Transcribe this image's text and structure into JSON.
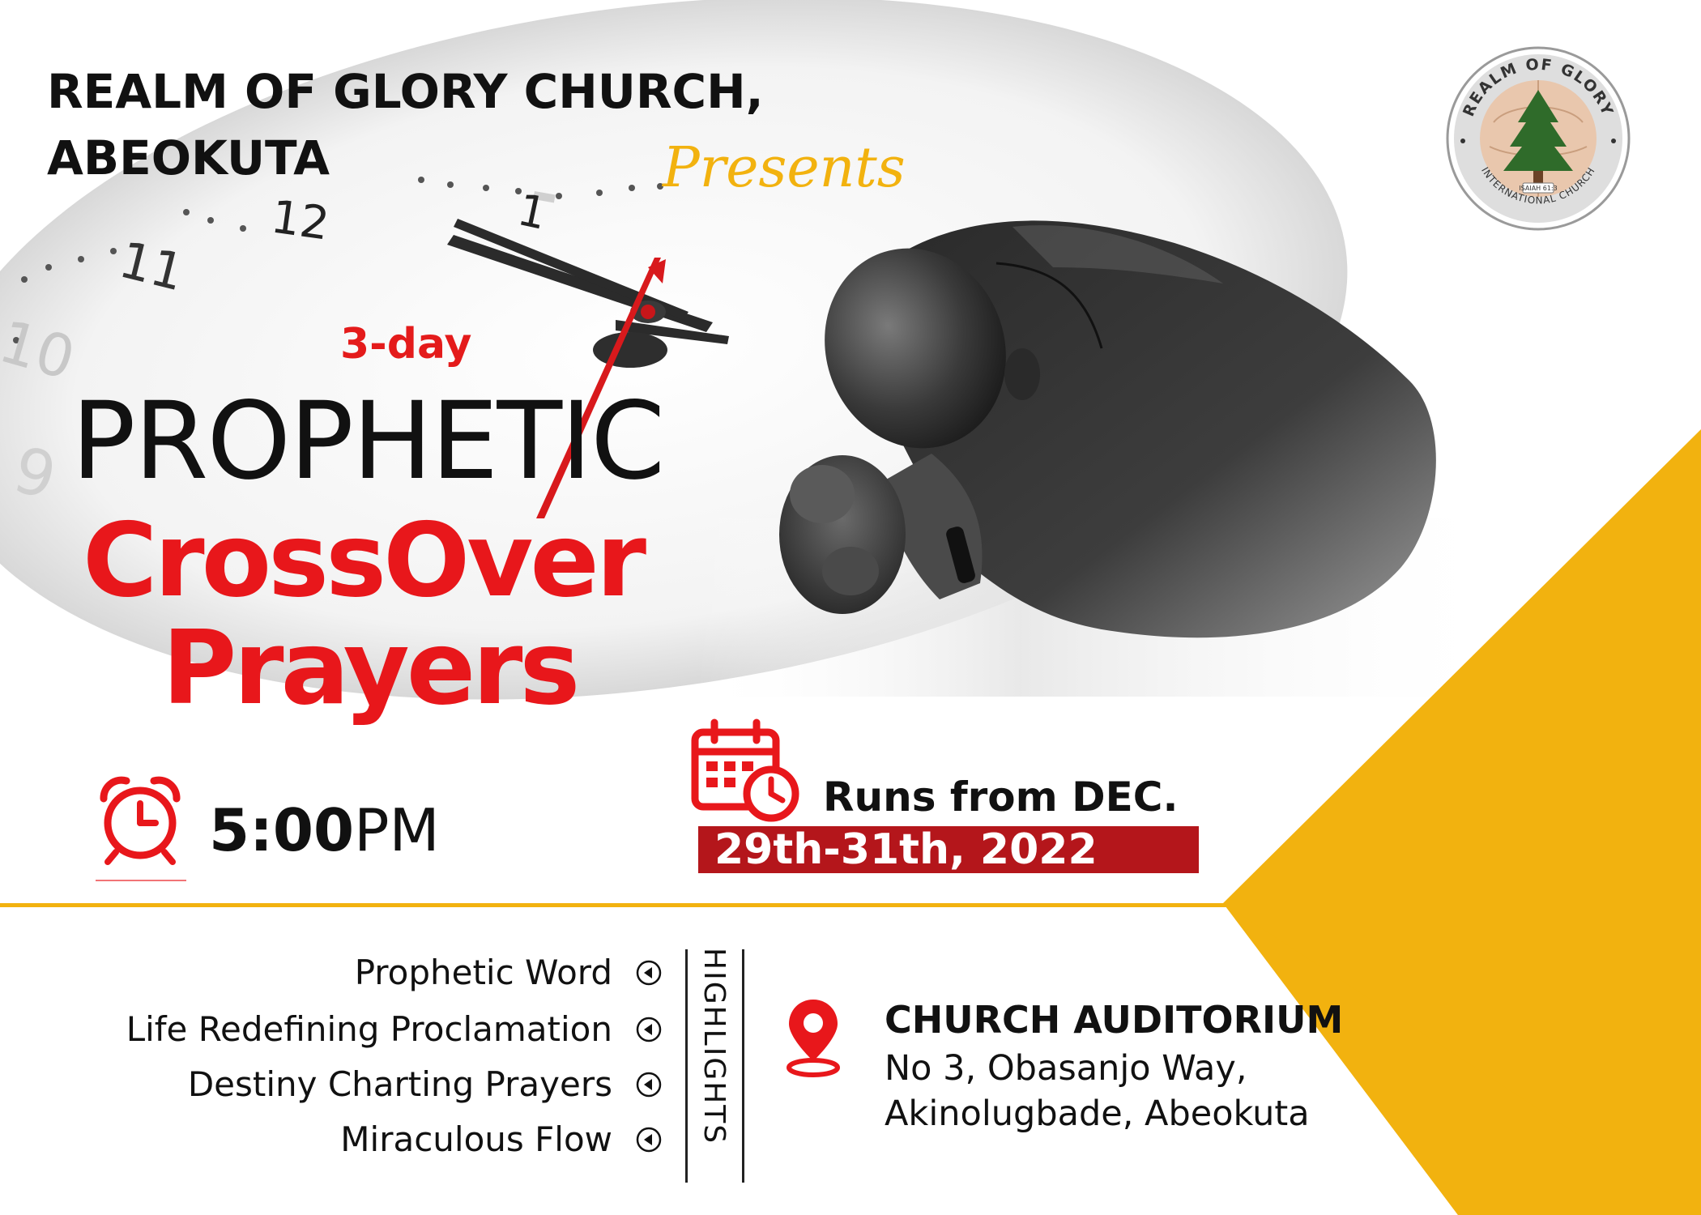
{
  "header": {
    "church_line1": "REALM OF GLORY CHURCH,",
    "church_line2": "ABEOKUTA",
    "presents": "Presents"
  },
  "logo": {
    "text_top": "REALM OF GLORY",
    "text_bottom": "INTERNATIONAL CHURCH",
    "scripture": "ISAIAH 61:3"
  },
  "clock": {
    "numerals": [
      "12",
      "11",
      "10",
      "9",
      "1"
    ]
  },
  "title": {
    "days": "3-day",
    "line1": "PROPHETIC",
    "line2": "CrossOver",
    "line3": "Prayers"
  },
  "time": {
    "bold": "5:00",
    "suffix": "PM"
  },
  "dates": {
    "runs_from": "Runs from DEC.",
    "range": "29th-31th, 2022"
  },
  "highlights": {
    "label": "HIGHLIGHTS",
    "items": [
      "Prophetic Word",
      "Life Redefining Proclamation",
      "Destiny Charting Prayers",
      "Miraculous Flow"
    ]
  },
  "venue": {
    "name": "CHURCH AUDITORIUM",
    "line1": "No 3, Obasanjo Way,",
    "line2": "Akinolugbade, Abeokuta"
  },
  "colors": {
    "accent_red": "#E8171B",
    "date_band": "#B4161B",
    "gold": "#F2B20F",
    "text": "#111111"
  },
  "icons": {
    "time": "alarm-clock-icon",
    "date": "calendar-clock-icon",
    "venue": "map-pin-icon",
    "bullet": "chevron-left-circle-icon"
  }
}
